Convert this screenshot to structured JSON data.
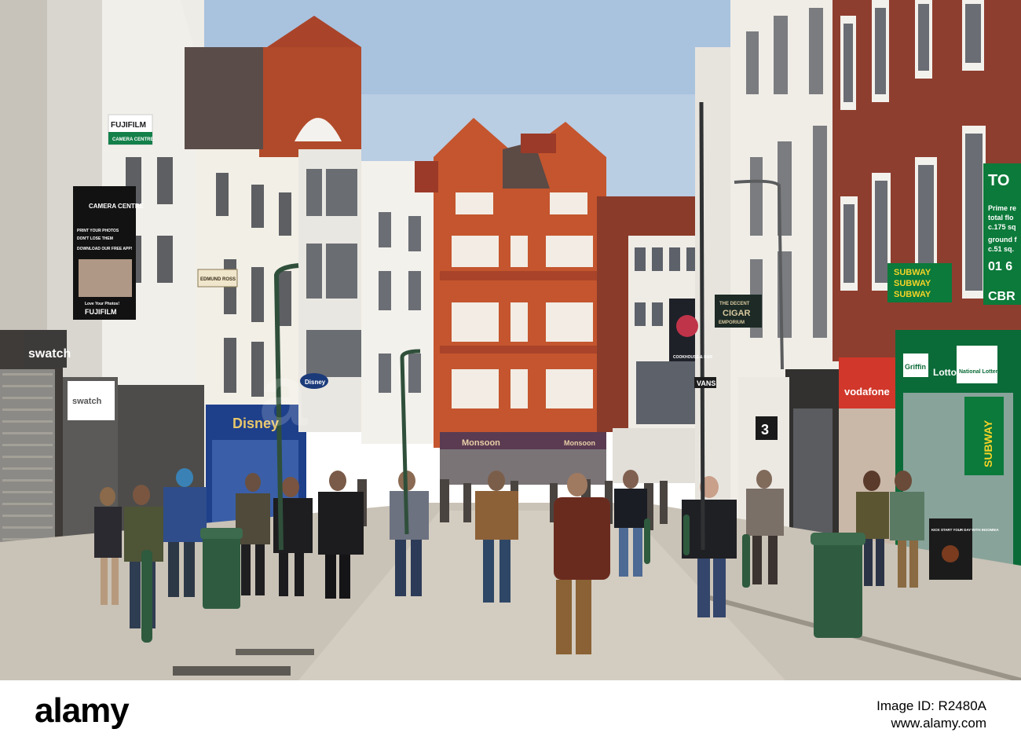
{
  "signs": {
    "fujifilm_top": "FUJIFILM",
    "camera_centre_small": "CAMERA CENTRE",
    "camera_centre_banner": "CAMERA CENTRE",
    "print_photos": "PRINT YOUR PHOTOS",
    "dont_lose": "DON'T LOSE THEM",
    "download_app": "DOWNLOAD OUR FREE APP!",
    "love_photos": "Love Your Photos!",
    "fujifilm_bottom": "FUJIFILM",
    "swatch": "swatch",
    "swatch_small": "swatch",
    "edmund_ross": "EDMUND ROSS",
    "disney_small": "Disney",
    "disney_shop": "Disney",
    "monsoon_left": "Monsoon",
    "monsoon_right": "Monsoon",
    "decent_cigar_1": "THE DECENT",
    "decent_cigar_2": "CIGAR",
    "decent_cigar_3": "EMPORIUM",
    "cookhouse": "COOKHOUSE & BAR",
    "vans": "VANS",
    "subway_1": "SUBWAY",
    "subway_2": "SUBWAY",
    "subway_3": "SUBWAY",
    "subway_vertical": "SUBWAY",
    "vodafone": "vodafone",
    "three": "3",
    "griffin": "Griffin",
    "lotto": "Lotto",
    "national_lottery": "National Lottery",
    "to_let_title": "TO",
    "to_let_prime": "Prime re",
    "to_let_total": "total flo",
    "to_let_175": "c.175 sq",
    "to_let_ground": "ground f",
    "to_let_51": "c.51 sq.",
    "to_let_phone": "01 6",
    "to_let_cbre": "CBR",
    "insomnia": "KICK START YOUR DAY WITH INSOMNIA"
  },
  "footer": {
    "logo": "alamy",
    "image_id": "Image ID: R2480A",
    "url": "www.alamy.com"
  },
  "watermark": "a",
  "colors": {
    "sky": "#b9cde3",
    "red_brick": "#c4552e",
    "dark_brick": "#8a3b2a",
    "pavement": "#c9c2b6",
    "bin_green": "#2f5c40",
    "subway_green": "#0b7a3b"
  }
}
